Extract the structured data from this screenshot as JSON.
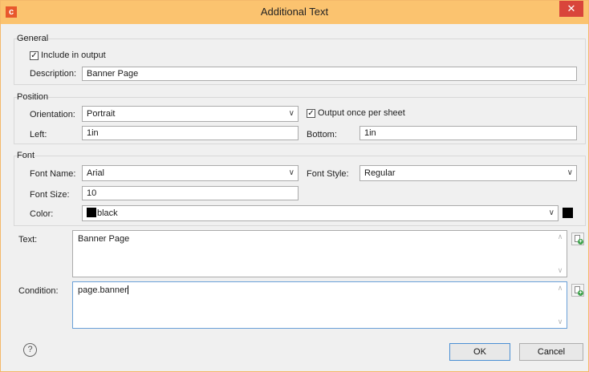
{
  "window": {
    "title": "Additional Text",
    "app_icon_letter": "c",
    "close_glyph": "✕"
  },
  "general": {
    "group_label": "General",
    "include_label": "Include in output",
    "include_checked": true,
    "description_label": "Description:",
    "description_value": "Banner Page"
  },
  "position": {
    "group_label": "Position",
    "orientation_label": "Orientation:",
    "orientation_value": "Portrait",
    "output_once_label": "Output once per sheet",
    "output_once_checked": true,
    "left_label": "Left:",
    "left_value": "1in",
    "bottom_label": "Bottom:",
    "bottom_value": "1in"
  },
  "font": {
    "group_label": "Font",
    "name_label": "Font Name:",
    "name_value": "Arial",
    "style_label": "Font Style:",
    "style_value": "Regular",
    "size_label": "Font Size:",
    "size_value": "10",
    "color_label": "Color:",
    "color_value": "black",
    "color_hex": "#000000"
  },
  "text": {
    "label": "Text:",
    "value": "Banner Page"
  },
  "condition": {
    "label": "Condition:",
    "value": "page.banner"
  },
  "buttons": {
    "ok": "OK",
    "cancel": "Cancel",
    "help_glyph": "?"
  },
  "colors": {
    "titlebar": "#fbc36f",
    "close": "#d9453b",
    "app_icon": "#e8572c"
  }
}
